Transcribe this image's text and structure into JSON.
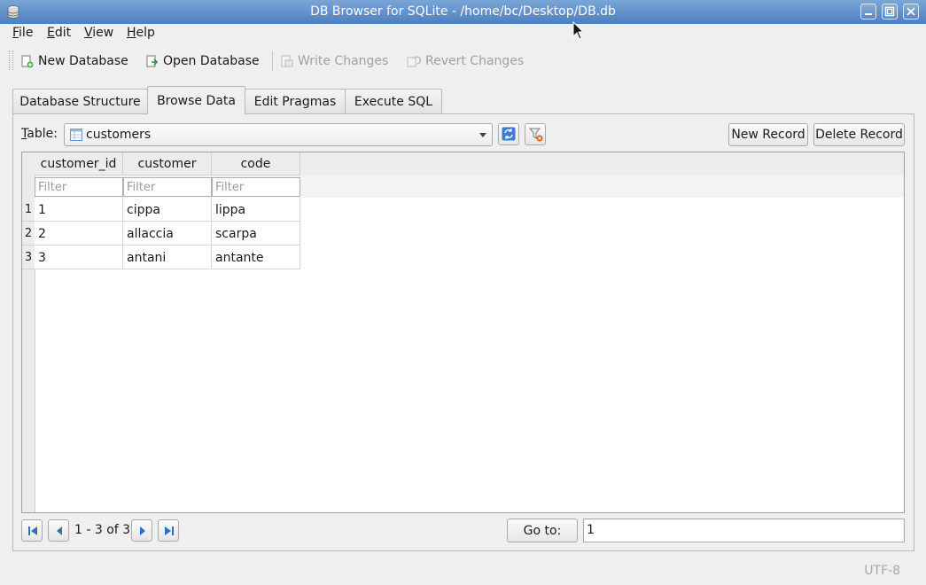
{
  "window": {
    "title": "DB Browser for SQLite - /home/bc/Desktop/DB.db"
  },
  "menu": [
    {
      "mnemonic": "F",
      "rest": "ile"
    },
    {
      "mnemonic": "E",
      "rest": "dit"
    },
    {
      "mnemonic": "V",
      "rest": "iew"
    },
    {
      "mnemonic": "H",
      "rest": "elp"
    }
  ],
  "toolbar": {
    "new_database": "New Database",
    "open_database": "Open Database",
    "write_changes": "Write Changes",
    "revert_changes": "Revert Changes"
  },
  "tabs": [
    "Database Structure",
    "Browse Data",
    "Edit Pragmas",
    "Execute SQL"
  ],
  "active_tab": "Browse Data",
  "browse": {
    "table_label_mnemonic": "T",
    "table_label_rest": "able:",
    "selected_table": "customers",
    "new_record": "New Record",
    "delete_record": "Delete Record",
    "columns": [
      "customer_id",
      "customer",
      "code"
    ],
    "filter_placeholder": "Filter",
    "rows": [
      {
        "num": "1",
        "cells": [
          "1",
          "cippa",
          "lippa"
        ]
      },
      {
        "num": "2",
        "cells": [
          "2",
          "allaccia",
          "scarpa"
        ]
      },
      {
        "num": "3",
        "cells": [
          "3",
          "antani",
          "antante"
        ]
      }
    ],
    "record_range": "1 - 3 of 3",
    "goto_label": "Go to:",
    "goto_value": "1"
  },
  "status": {
    "encoding": "UTF-8"
  },
  "colors": {
    "titlebar": "#5a8ac6",
    "accent": "#2f6fbf"
  }
}
